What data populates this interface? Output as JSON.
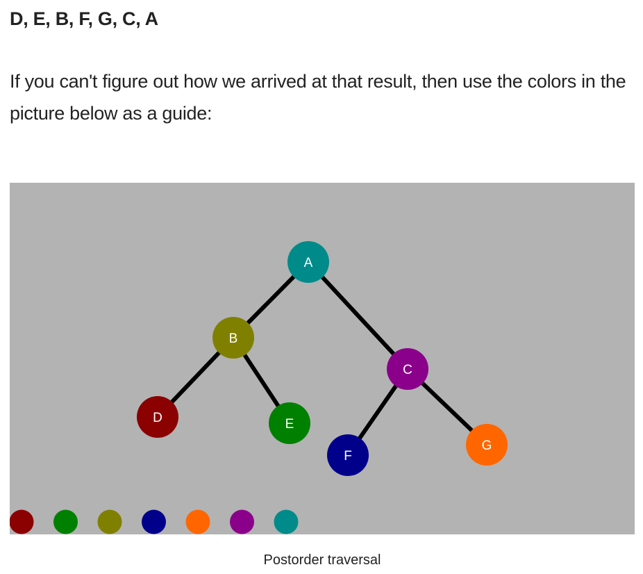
{
  "text": {
    "result": "D, E, B, F, G, C, A",
    "paragraph": "If you can't figure out how we arrived at that result, then use the colors in the picture below as a guide:",
    "caption": "Postorder traversal"
  },
  "colors": {
    "figure_bg": "#b3b3b3",
    "edge": "#000000",
    "node_text": "#ffffff"
  },
  "tree": {
    "nodes": [
      {
        "id": "A",
        "label": "A",
        "color": "#008b8b"
      },
      {
        "id": "B",
        "label": "B",
        "color": "#808000"
      },
      {
        "id": "C",
        "label": "C",
        "color": "#8b008b"
      },
      {
        "id": "D",
        "label": "D",
        "color": "#8b0000"
      },
      {
        "id": "E",
        "label": "E",
        "color": "#008000"
      },
      {
        "id": "F",
        "label": "F",
        "color": "#00008b"
      },
      {
        "id": "G",
        "label": "G",
        "color": "#ff6600"
      }
    ],
    "edges": [
      [
        "A",
        "B"
      ],
      [
        "A",
        "C"
      ],
      [
        "B",
        "D"
      ],
      [
        "B",
        "E"
      ],
      [
        "C",
        "F"
      ],
      [
        "C",
        "G"
      ]
    ]
  },
  "traversal_order": [
    "D",
    "E",
    "B",
    "F",
    "G",
    "C",
    "A"
  ]
}
